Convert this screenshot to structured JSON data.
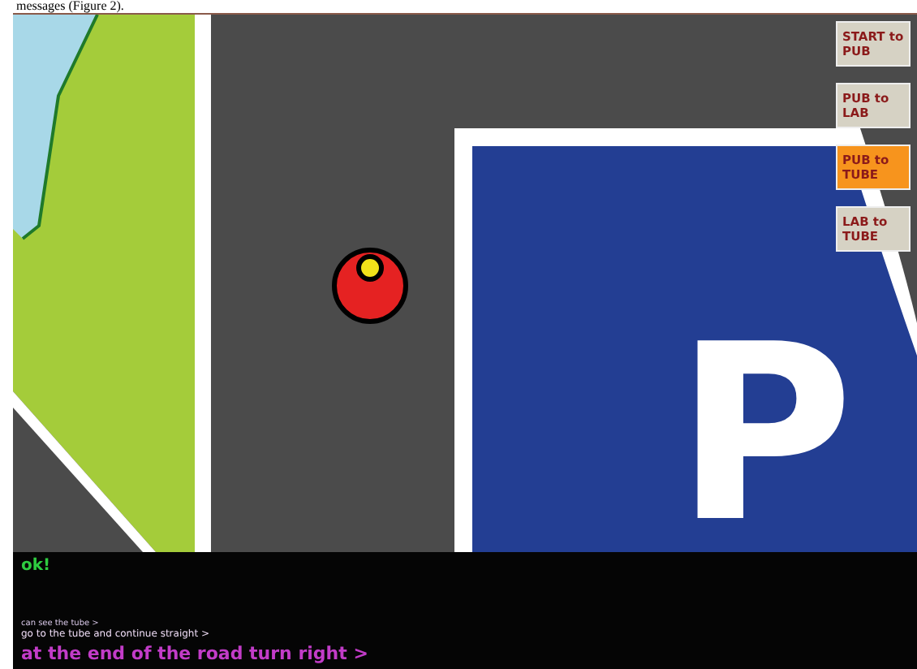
{
  "caption": "messages (Figure 2).",
  "map": {
    "parking_sign": "P"
  },
  "route_buttons": [
    {
      "label": "START to PUB",
      "selected": false
    },
    {
      "label": "PUB to LAB",
      "selected": false
    },
    {
      "label": "PUB to TUBE",
      "selected": true
    },
    {
      "label": "LAB to TUBE",
      "selected": false
    }
  ],
  "console": {
    "status": "ok!",
    "messages": [
      {
        "text": "can see the tube >",
        "kind": "old"
      },
      {
        "text": "go to the tube and continue straight >",
        "kind": "recent"
      },
      {
        "text": "at the end of the road turn right >",
        "kind": "current"
      }
    ]
  }
}
